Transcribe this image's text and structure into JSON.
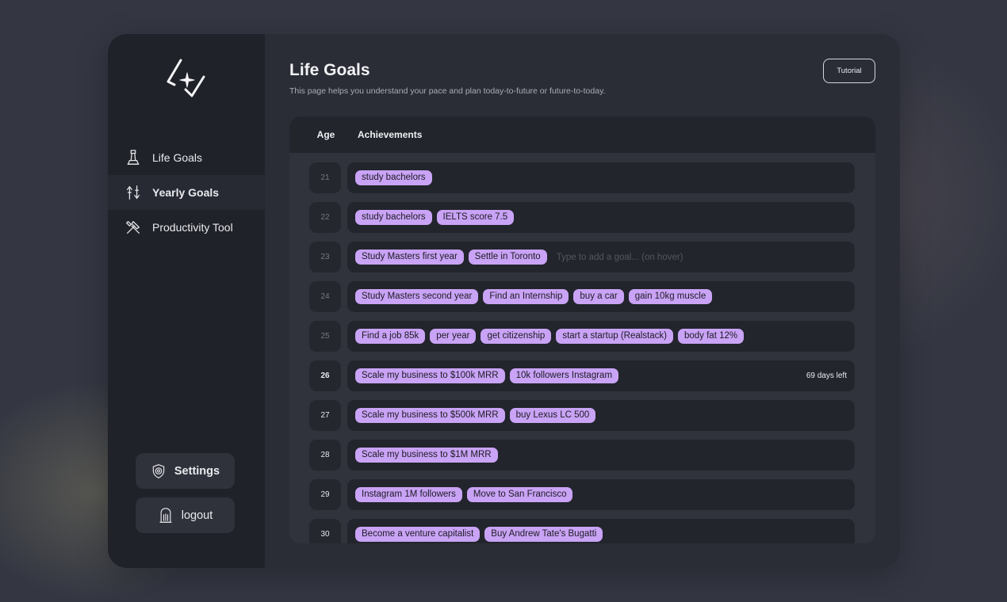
{
  "sidebar": {
    "nav": [
      {
        "label": "Life Goals",
        "icon": "tower-icon"
      },
      {
        "label": "Yearly Goals",
        "icon": "arrows-icon"
      },
      {
        "label": "Productivity Tool",
        "icon": "tools-icon"
      }
    ],
    "active_index": 1,
    "settings_label": "Settings",
    "logout_label": "logout"
  },
  "header": {
    "title": "Life Goals",
    "subtitle": "This page helps you understand your pace and plan today-to-future or future-to-today.",
    "tutorial_label": "Tutorial"
  },
  "table": {
    "col_age": "Age",
    "col_achievements": "Achievements",
    "rows": [
      {
        "age": "21",
        "goals": [
          "study bachelors"
        ]
      },
      {
        "age": "22",
        "goals": [
          "study bachelors",
          "IELTS score 7.5"
        ]
      },
      {
        "age": "23",
        "goals": [
          "Study Masters first year",
          "Settle in Toronto"
        ],
        "placeholder": "Type to add a goal... (on hover)"
      },
      {
        "age": "24",
        "goals": [
          "Study Masters second year",
          "Find an Internship",
          "buy a car",
          "gain 10kg muscle"
        ]
      },
      {
        "age": "25",
        "goals": [
          "Find a job 85k",
          "per year",
          "get citizenship",
          "start a startup (Realstack)",
          "body fat 12%"
        ]
      },
      {
        "age": "26",
        "goals": [
          "Scale my business to $100k MRR",
          "10k followers Instagram"
        ],
        "days_left": "69 days left",
        "current": true
      },
      {
        "age": "27",
        "goals": [
          "Scale my business to $500k MRR",
          "buy Lexus LC 500"
        ]
      },
      {
        "age": "28",
        "goals": [
          "Scale my business to $1M MRR"
        ]
      },
      {
        "age": "29",
        "goals": [
          "Instagram 1M followers",
          "Move to San Francisco"
        ]
      },
      {
        "age": "30",
        "goals": [
          "Become a venture capitalist",
          "Buy Andrew Tate's  Bugatti"
        ]
      }
    ]
  },
  "colors": {
    "tag": "#c9a3f5",
    "sidebar_bg": "#1f2229",
    "main_bg": "#2a2d36"
  }
}
